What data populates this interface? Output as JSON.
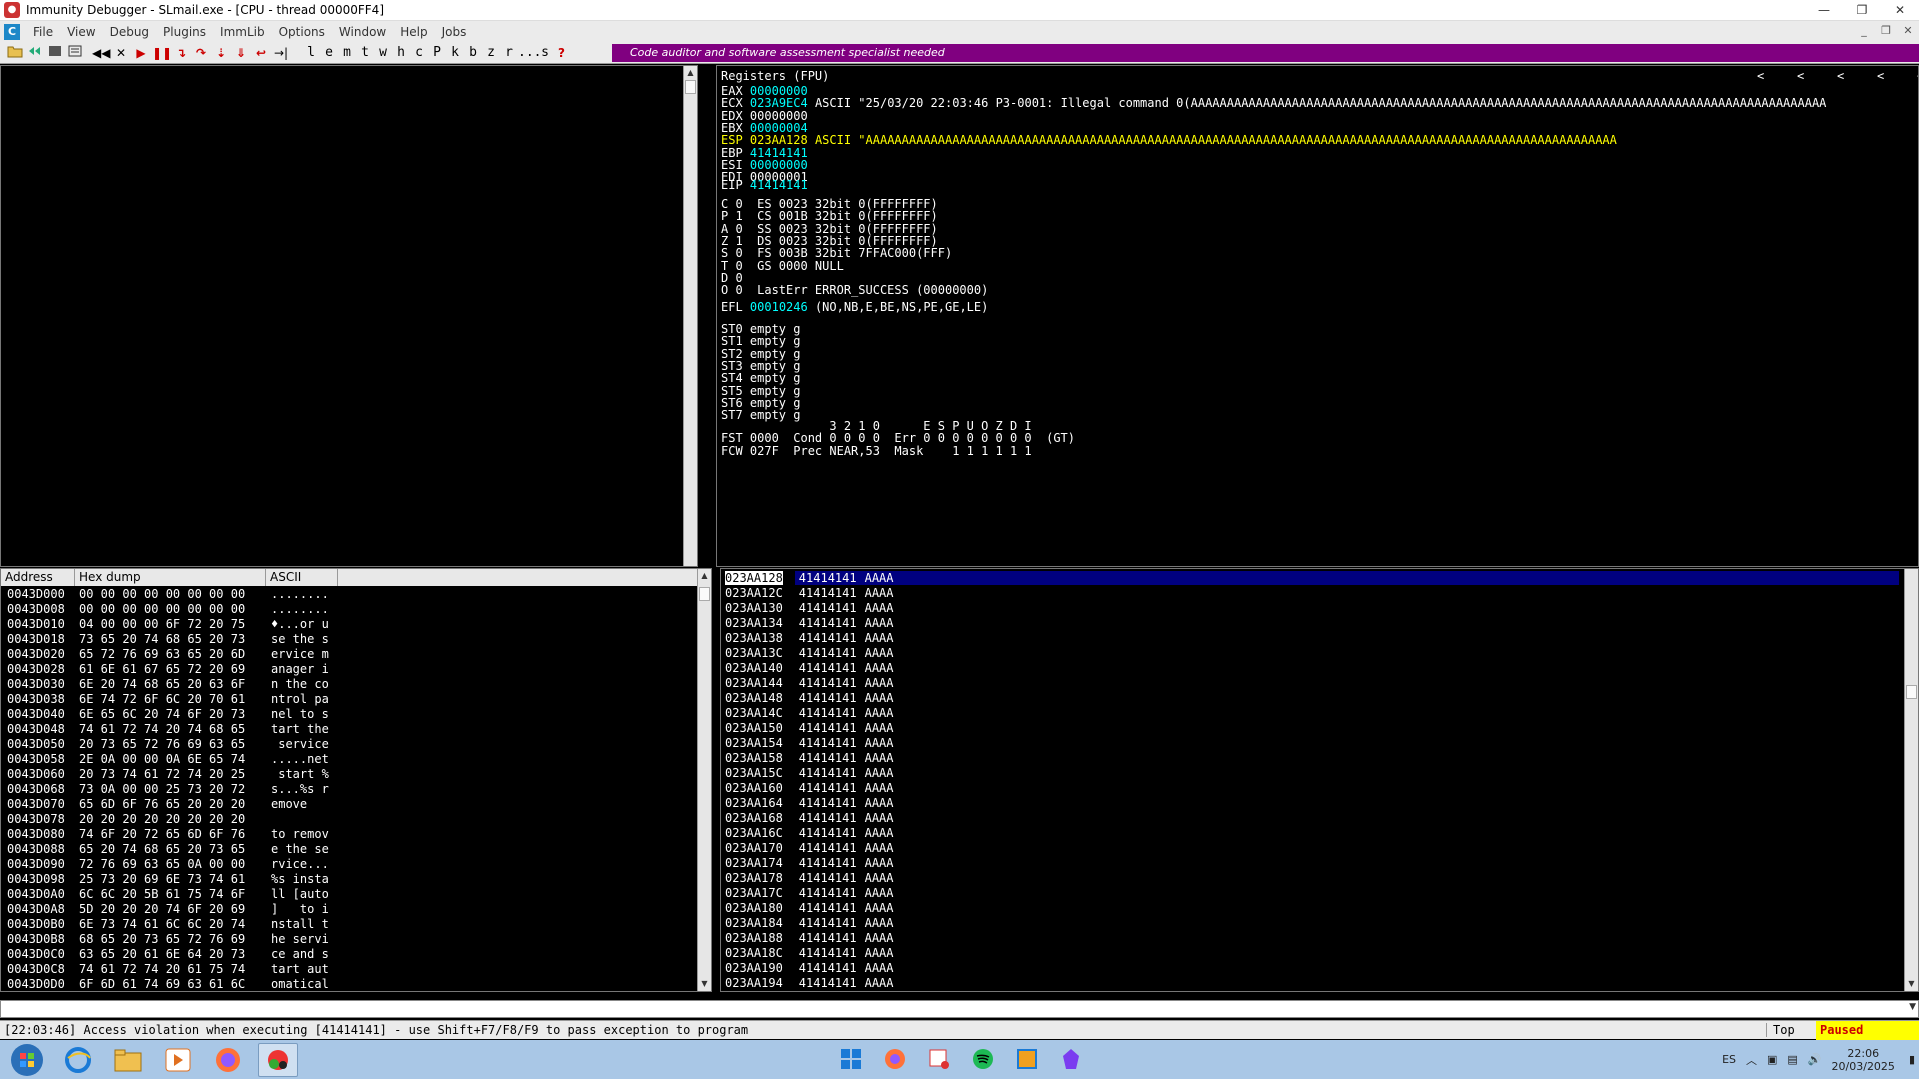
{
  "window": {
    "title": "Immunity Debugger - SLmail.exe - [CPU - thread 00000FF4]",
    "controls": [
      "—",
      "❐",
      "✕"
    ]
  },
  "menu": {
    "items": [
      "File",
      "View",
      "Debug",
      "Plugins",
      "ImmLib",
      "Options",
      "Window",
      "Help",
      "Jobs"
    ],
    "mdi_controls": [
      "_",
      "❐",
      "✕"
    ]
  },
  "toolbar": {
    "letters": [
      "l",
      "e",
      "m",
      "t",
      "w",
      "h",
      "c",
      "P",
      "k",
      "b",
      "z",
      "r",
      "...",
      "s"
    ],
    "help": "?",
    "banner": "Code auditor and software assessment specialist needed"
  },
  "registers": {
    "header": "Registers (FPU)",
    "arrows": [
      "<",
      "<",
      "<",
      "<",
      "<",
      "<",
      "<",
      "<",
      "<",
      "<",
      "<",
      "<",
      "<"
    ],
    "gp": [
      {
        "name": "EAX",
        "value": "00000000",
        "comment": ""
      },
      {
        "name": "ECX",
        "value": "023A9EC4",
        "comment": "ASCII \"25/03/20 22:03:46 P3-0001: Illegal command 0(AAAAAAAAAAAAAAAAAAAAAAAAAAAAAAAAAAAAAAAAAAAAAAAAAAAAAAAAAAAAAAAAAAAAAAAAAAAAAAAAAAAAAAAA"
      },
      {
        "name": "EDX",
        "value": "00000000",
        "comment": ""
      },
      {
        "name": "EBX",
        "value": "00000004",
        "comment": ""
      },
      {
        "name": "ESP",
        "value": "023AA128",
        "comment": "ASCII \"AAAAAAAAAAAAAAAAAAAAAAAAAAAAAAAAAAAAAAAAAAAAAAAAAAAAAAAAAAAAAAAAAAAAAAAAAAAAAAAAAAAAAAAAAAAAAAAAAAAAAAAA"
      },
      {
        "name": "EBP",
        "value": "41414141",
        "comment": ""
      },
      {
        "name": "ESI",
        "value": "00000000",
        "comment": ""
      },
      {
        "name": "EDI",
        "value": "00000001",
        "comment": ""
      }
    ],
    "eip": {
      "name": "EIP",
      "value": "41414141"
    },
    "flags": [
      "C 0  ES 0023 32bit 0(FFFFFFFF)",
      "P 1  CS 001B 32bit 0(FFFFFFFF)",
      "A 0  SS 0023 32bit 0(FFFFFFFF)",
      "Z 1  DS 0023 32bit 0(FFFFFFFF)",
      "S 0  FS 003B 32bit 7FFAC000(FFF)",
      "T 0  GS 0000 NULL",
      "D 0",
      "O 0  LastErr ERROR_SUCCESS (00000000)"
    ],
    "efl": {
      "label": "EFL",
      "value": "00010246",
      "comment": "(NO,NB,E,BE,NS,PE,GE,LE)"
    },
    "fpu": [
      "ST0 empty g",
      "ST1 empty g",
      "ST2 empty g",
      "ST3 empty g",
      "ST4 empty g",
      "ST5 empty g",
      "ST6 empty g",
      "ST7 empty g"
    ],
    "fpu_status": [
      "               3 2 1 0      E S P U O Z D I",
      "FST 0000  Cond 0 0 0 0  Err 0 0 0 0 0 0 0 0  (GT)",
      "FCW 027F  Prec NEAR,53  Mask    1 1 1 1 1 1"
    ]
  },
  "dump": {
    "columns": [
      "Address",
      "Hex dump",
      "ASCII"
    ],
    "rows": [
      {
        "addr": "0043D000",
        "hex": "00 00 00 00 00 00 00 00",
        "ascii": "........"
      },
      {
        "addr": "0043D008",
        "hex": "00 00 00 00 00 00 00 00",
        "ascii": "........"
      },
      {
        "addr": "0043D010",
        "hex": "04 00 00 00 6F 72 20 75",
        "ascii": "♦...or u"
      },
      {
        "addr": "0043D018",
        "hex": "73 65 20 74 68 65 20 73",
        "ascii": "se the s"
      },
      {
        "addr": "0043D020",
        "hex": "65 72 76 69 63 65 20 6D",
        "ascii": "ervice m"
      },
      {
        "addr": "0043D028",
        "hex": "61 6E 61 67 65 72 20 69",
        "ascii": "anager i"
      },
      {
        "addr": "0043D030",
        "hex": "6E 20 74 68 65 20 63 6F",
        "ascii": "n the co"
      },
      {
        "addr": "0043D038",
        "hex": "6E 74 72 6F 6C 20 70 61",
        "ascii": "ntrol pa"
      },
      {
        "addr": "0043D040",
        "hex": "6E 65 6C 20 74 6F 20 73",
        "ascii": "nel to s"
      },
      {
        "addr": "0043D048",
        "hex": "74 61 72 74 20 74 68 65",
        "ascii": "tart the"
      },
      {
        "addr": "0043D050",
        "hex": "20 73 65 72 76 69 63 65",
        "ascii": " service"
      },
      {
        "addr": "0043D058",
        "hex": "2E 0A 00 00 0A 6E 65 74",
        "ascii": ".....net"
      },
      {
        "addr": "0043D060",
        "hex": "20 73 74 61 72 74 20 25",
        "ascii": " start %"
      },
      {
        "addr": "0043D068",
        "hex": "73 0A 00 00 25 73 20 72",
        "ascii": "s...%s r"
      },
      {
        "addr": "0043D070",
        "hex": "65 6D 6F 76 65 20 20 20",
        "ascii": "emove"
      },
      {
        "addr": "0043D078",
        "hex": "20 20 20 20 20 20 20 20",
        "ascii": ""
      },
      {
        "addr": "0043D080",
        "hex": "74 6F 20 72 65 6D 6F 76",
        "ascii": "to remov"
      },
      {
        "addr": "0043D088",
        "hex": "65 20 74 68 65 20 73 65",
        "ascii": "e the se"
      },
      {
        "addr": "0043D090",
        "hex": "72 76 69 63 65 0A 00 00",
        "ascii": "rvice..."
      },
      {
        "addr": "0043D098",
        "hex": "25 73 20 69 6E 73 74 61",
        "ascii": "%s insta"
      },
      {
        "addr": "0043D0A0",
        "hex": "6C 6C 20 5B 61 75 74 6F",
        "ascii": "ll [auto"
      },
      {
        "addr": "0043D0A8",
        "hex": "5D 20 20 20 74 6F 20 69",
        "ascii": "]   to i"
      },
      {
        "addr": "0043D0B0",
        "hex": "6E 73 74 61 6C 6C 20 74",
        "ascii": "nstall t"
      },
      {
        "addr": "0043D0B8",
        "hex": "68 65 20 73 65 72 76 69",
        "ascii": "he servi"
      },
      {
        "addr": "0043D0C0",
        "hex": "63 65 20 61 6E 64 20 73",
        "ascii": "ce and s"
      },
      {
        "addr": "0043D0C8",
        "hex": "74 61 72 74 20 61 75 74",
        "ascii": "tart aut"
      },
      {
        "addr": "0043D0D0",
        "hex": "6F 6D 61 74 69 63 61 6C",
        "ascii": "omatical"
      }
    ]
  },
  "stack": {
    "rows": [
      {
        "addr": "023AA128",
        "val": "41414141",
        "comment": "AAAA"
      },
      {
        "addr": "023AA12C",
        "val": "41414141",
        "comment": "AAAA"
      },
      {
        "addr": "023AA130",
        "val": "41414141",
        "comment": "AAAA"
      },
      {
        "addr": "023AA134",
        "val": "41414141",
        "comment": "AAAA"
      },
      {
        "addr": "023AA138",
        "val": "41414141",
        "comment": "AAAA"
      },
      {
        "addr": "023AA13C",
        "val": "41414141",
        "comment": "AAAA"
      },
      {
        "addr": "023AA140",
        "val": "41414141",
        "comment": "AAAA"
      },
      {
        "addr": "023AA144",
        "val": "41414141",
        "comment": "AAAA"
      },
      {
        "addr": "023AA148",
        "val": "41414141",
        "comment": "AAAA"
      },
      {
        "addr": "023AA14C",
        "val": "41414141",
        "comment": "AAAA"
      },
      {
        "addr": "023AA150",
        "val": "41414141",
        "comment": "AAAA"
      },
      {
        "addr": "023AA154",
        "val": "41414141",
        "comment": "AAAA"
      },
      {
        "addr": "023AA158",
        "val": "41414141",
        "comment": "AAAA"
      },
      {
        "addr": "023AA15C",
        "val": "41414141",
        "comment": "AAAA"
      },
      {
        "addr": "023AA160",
        "val": "41414141",
        "comment": "AAAA"
      },
      {
        "addr": "023AA164",
        "val": "41414141",
        "comment": "AAAA"
      },
      {
        "addr": "023AA168",
        "val": "41414141",
        "comment": "AAAA"
      },
      {
        "addr": "023AA16C",
        "val": "41414141",
        "comment": "AAAA"
      },
      {
        "addr": "023AA170",
        "val": "41414141",
        "comment": "AAAA"
      },
      {
        "addr": "023AA174",
        "val": "41414141",
        "comment": "AAAA"
      },
      {
        "addr": "023AA178",
        "val": "41414141",
        "comment": "AAAA"
      },
      {
        "addr": "023AA17C",
        "val": "41414141",
        "comment": "AAAA"
      },
      {
        "addr": "023AA180",
        "val": "41414141",
        "comment": "AAAA"
      },
      {
        "addr": "023AA184",
        "val": "41414141",
        "comment": "AAAA"
      },
      {
        "addr": "023AA188",
        "val": "41414141",
        "comment": "AAAA"
      },
      {
        "addr": "023AA18C",
        "val": "41414141",
        "comment": "AAAA"
      },
      {
        "addr": "023AA190",
        "val": "41414141",
        "comment": "AAAA"
      },
      {
        "addr": "023AA194",
        "val": "41414141",
        "comment": "AAAA"
      }
    ]
  },
  "status": {
    "message": "[22:03:46] Access violation when executing [41414141] - use Shift+F7/F8/F9 to pass exception to program",
    "scroll_mode": "Top",
    "state": "Paused"
  },
  "taskbar": {
    "lang": "ES",
    "time": "22:06",
    "date": "20/03/2025"
  },
  "colors": {
    "register_changed": "#00ffff",
    "esp_highlight": "#ffff00",
    "banner": "#800080",
    "selection": "#000080",
    "paused_bg": "#ffff00"
  }
}
